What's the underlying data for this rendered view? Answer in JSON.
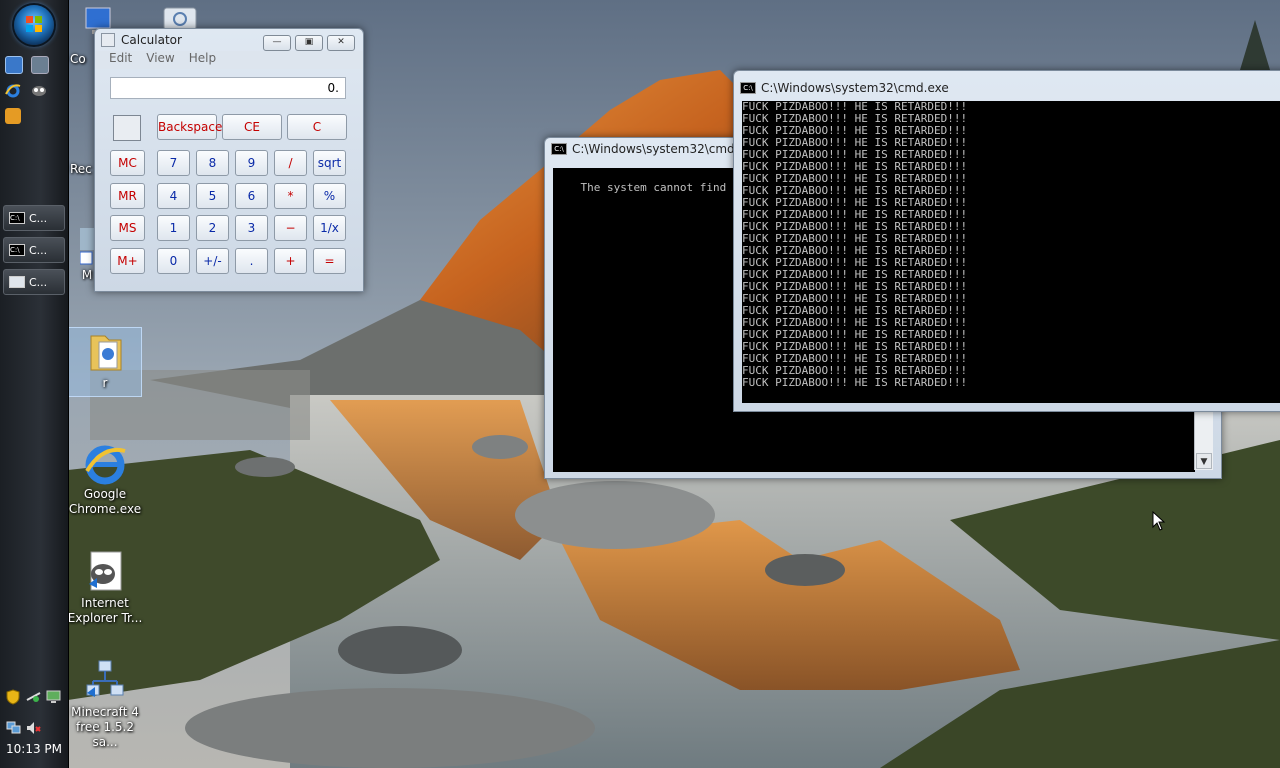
{
  "taskbar": {
    "start_label": "Start",
    "buttons": [
      {
        "label": "C..."
      },
      {
        "label": "C..."
      },
      {
        "label": "C..."
      }
    ],
    "clock": "10:13 PM"
  },
  "desktop_icons": [
    {
      "label": "Co",
      "icon": "computer-icon"
    },
    {
      "label": "Rec",
      "icon": "recycle-bin-icon"
    },
    {
      "label": "M",
      "icon": "shortcut-icon"
    },
    {
      "label": "r",
      "icon": "folder-icon"
    },
    {
      "label": "Google Chrome.exe",
      "icon": "internet-explorer-icon"
    },
    {
      "label": "Internet Explorer Tr...",
      "icon": "raccoon-icon"
    },
    {
      "label": "Minecraft 4 free 1.5.2 sa...",
      "icon": "network-icon"
    }
  ],
  "calculator": {
    "title": "Calculator",
    "menu": [
      "Edit",
      "View",
      "Help"
    ],
    "display": "0.",
    "keys": {
      "backspace": "Backspace",
      "ce": "CE",
      "c": "C",
      "mc": "MC",
      "mr": "MR",
      "ms": "MS",
      "mplus": "M+",
      "k7": "7",
      "k8": "8",
      "k9": "9",
      "div": "/",
      "sqrt": "sqrt",
      "k4": "4",
      "k5": "5",
      "k6": "6",
      "mul": "*",
      "pct": "%",
      "k1": "1",
      "k2": "2",
      "k3": "3",
      "sub": "−",
      "inv": "1/x",
      "k0": "0",
      "sign": "+/-",
      "dot": ".",
      "add": "+",
      "eq": "="
    }
  },
  "cmd_back": {
    "title": "C:\\Windows\\system32\\cmd.exe",
    "output": "The system cannot find"
  },
  "cmd_front": {
    "title": "C:\\Windows\\system32\\cmd.exe",
    "line": "FUCK PIZDABOO!!! HE IS RETARDED!!!",
    "line_count": 24
  },
  "colors": {
    "taskbar": "#23272d",
    "console_bg": "#000000",
    "console_fg": "#c0c0c0",
    "calc_red": "#c40000",
    "calc_blue": "#0a2aa8"
  }
}
